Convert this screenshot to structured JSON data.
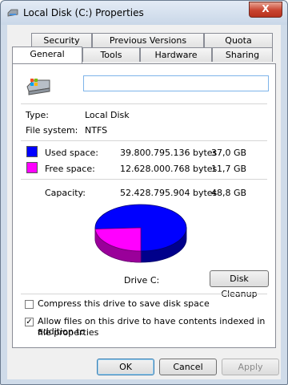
{
  "window": {
    "title": "Local Disk (C:) Properties",
    "close_label": "X"
  },
  "tabs_row1": [
    "Security",
    "Previous Versions",
    "Quota"
  ],
  "tabs_row2": [
    "General",
    "Tools",
    "Hardware",
    "Sharing"
  ],
  "active_tab": "General",
  "general": {
    "name_value": "",
    "type_label": "Type:",
    "type_value": "Local Disk",
    "fs_label": "File system:",
    "fs_value": "NTFS",
    "used_label": "Used space:",
    "used_bytes": "39.800.795.136 bytes",
    "used_gb": "37,0 GB",
    "free_label": "Free space:",
    "free_bytes": "12.628.000.768 bytes",
    "free_gb": "11,7 GB",
    "cap_label": "Capacity:",
    "cap_bytes": "52.428.795.904 bytes",
    "cap_gb": "48,8 GB",
    "drive_label": "Drive C:",
    "cleanup_button": "Disk Cleanup",
    "compress_label": "Compress this drive to save disk space",
    "compress_checked": false,
    "index_label_line1": "Allow files on this drive to have contents indexed in addition to",
    "index_label_line2": "file properties",
    "index_checked": true,
    "used_color": "#0000ff",
    "free_color": "#ff00ff",
    "used_fraction": 0.759
  },
  "buttons": {
    "ok": "OK",
    "cancel": "Cancel",
    "apply": "Apply"
  }
}
